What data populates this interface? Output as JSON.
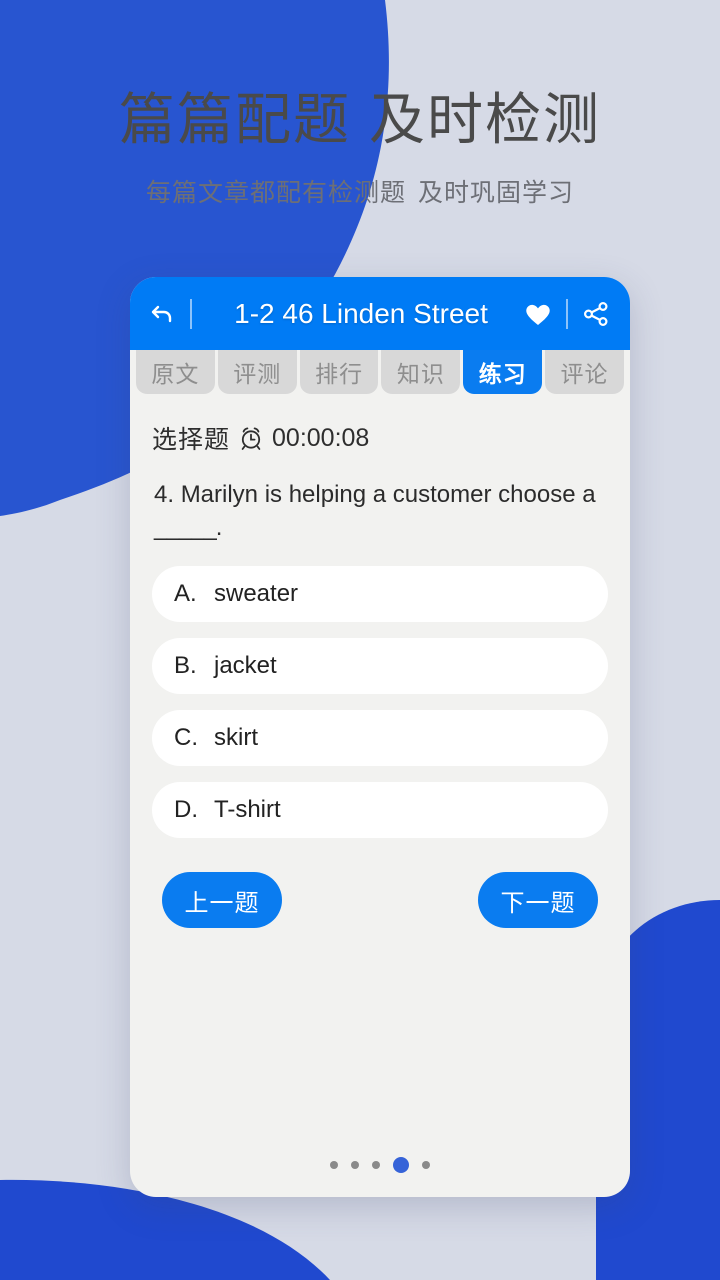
{
  "promo": {
    "headline_left": "篇篇配题",
    "headline_right": "及时检测",
    "subhead_left": "每篇文章都配有检测题",
    "subhead_right": "及时巩固学习"
  },
  "colors": {
    "page_background": "#d6dae6",
    "blob_blue": "#2855d0",
    "appbar_blue": "#007bf5",
    "button_blue": "#0a7cf0",
    "screen_background": "#f2f2f0",
    "tab_inactive": "#d8d8d8",
    "dot_active": "#3663d8"
  },
  "appbar": {
    "back_icon": "back-arrow-icon",
    "title": "1-2 46 Linden Street",
    "favorite_icon": "heart-icon",
    "share_icon": "share-icon"
  },
  "tabs": [
    {
      "label": "原文",
      "active": false
    },
    {
      "label": "评测",
      "active": false
    },
    {
      "label": "排行",
      "active": false
    },
    {
      "label": "知识",
      "active": false
    },
    {
      "label": "练习",
      "active": true
    },
    {
      "label": "评论",
      "active": false
    }
  ],
  "quiz": {
    "type_label": "选择题",
    "clock_icon": "alarm-clock-icon",
    "timer": "00:00:08",
    "question_number": "4.",
    "question_text": "Marilyn is helping a customer choose a",
    "question_blank": "_____.",
    "options": [
      {
        "key": "A.",
        "text": "sweater"
      },
      {
        "key": "B.",
        "text": "jacket"
      },
      {
        "key": "C.",
        "text": "skirt"
      },
      {
        "key": "D.",
        "text": "T-shirt"
      }
    ],
    "prev_button": "上一题",
    "next_button": "下一题"
  },
  "pagination": {
    "total": 5,
    "active_index": 3
  }
}
